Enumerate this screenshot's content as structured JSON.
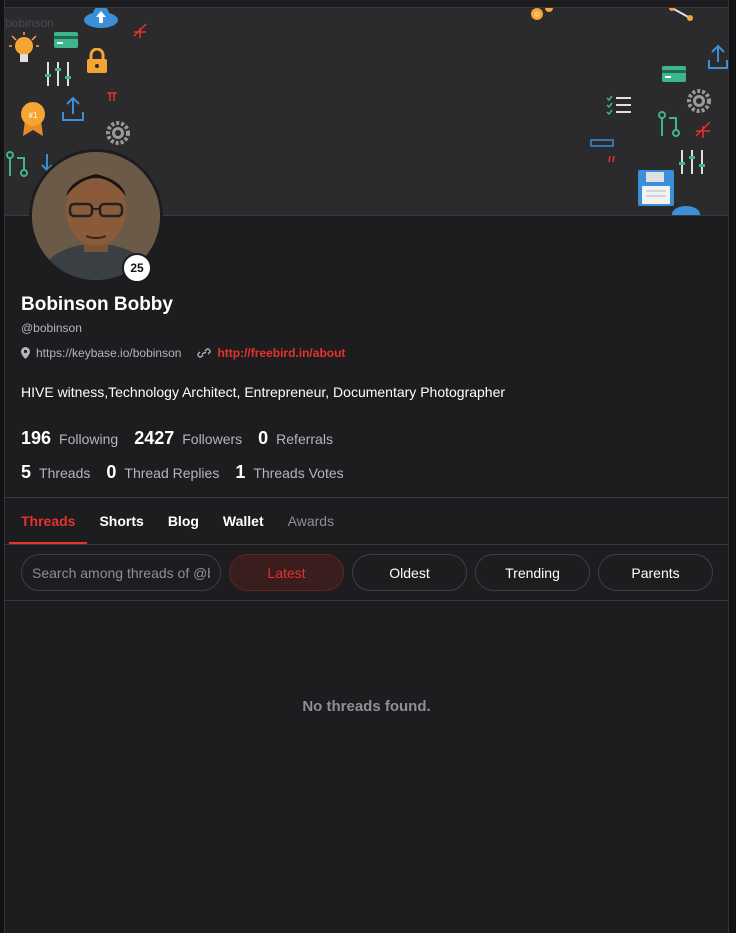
{
  "cover": {
    "alt_text": "bobinson"
  },
  "profile": {
    "reputation": "25",
    "display_name": "Bobinson Bobby",
    "handle": "@bobinson",
    "location": "https://keybase.io/bobinson",
    "website": "http://freebird.in/about",
    "bio": "HIVE witness,Technology Architect, Entrepreneur, Documentary Photographer"
  },
  "stats_row1": [
    {
      "value": "196",
      "label": "Following"
    },
    {
      "value": "2427",
      "label": "Followers"
    },
    {
      "value": "0",
      "label": "Referrals"
    }
  ],
  "stats_row2": [
    {
      "value": "5",
      "label": "Threads"
    },
    {
      "value": "0",
      "label": "Thread Replies"
    },
    {
      "value": "1",
      "label": "Threads Votes"
    }
  ],
  "tabs": [
    "Threads",
    "Shorts",
    "Blog",
    "Wallet",
    "Awards"
  ],
  "search": {
    "placeholder": "Search among threads of @bobinson"
  },
  "filters": [
    "Latest",
    "Oldest",
    "Trending",
    "Parents"
  ],
  "empty_message": "No threads found.",
  "colors": {
    "accent": "#e5322d",
    "background": "#1d1d20",
    "cover": "#2b2b2e"
  },
  "icons": [
    "cloud-upload-icon",
    "lightbulb-icon",
    "credit-card-icon",
    "lock-icon",
    "sliders-icon",
    "badge-icon",
    "upload-arrow-icon",
    "pi-icon",
    "gear-icon",
    "git-pull-icon",
    "download-arrow-icon",
    "checklist-icon",
    "floppy-disk-icon",
    "share-icon",
    "map-pin-icon",
    "link-icon"
  ]
}
